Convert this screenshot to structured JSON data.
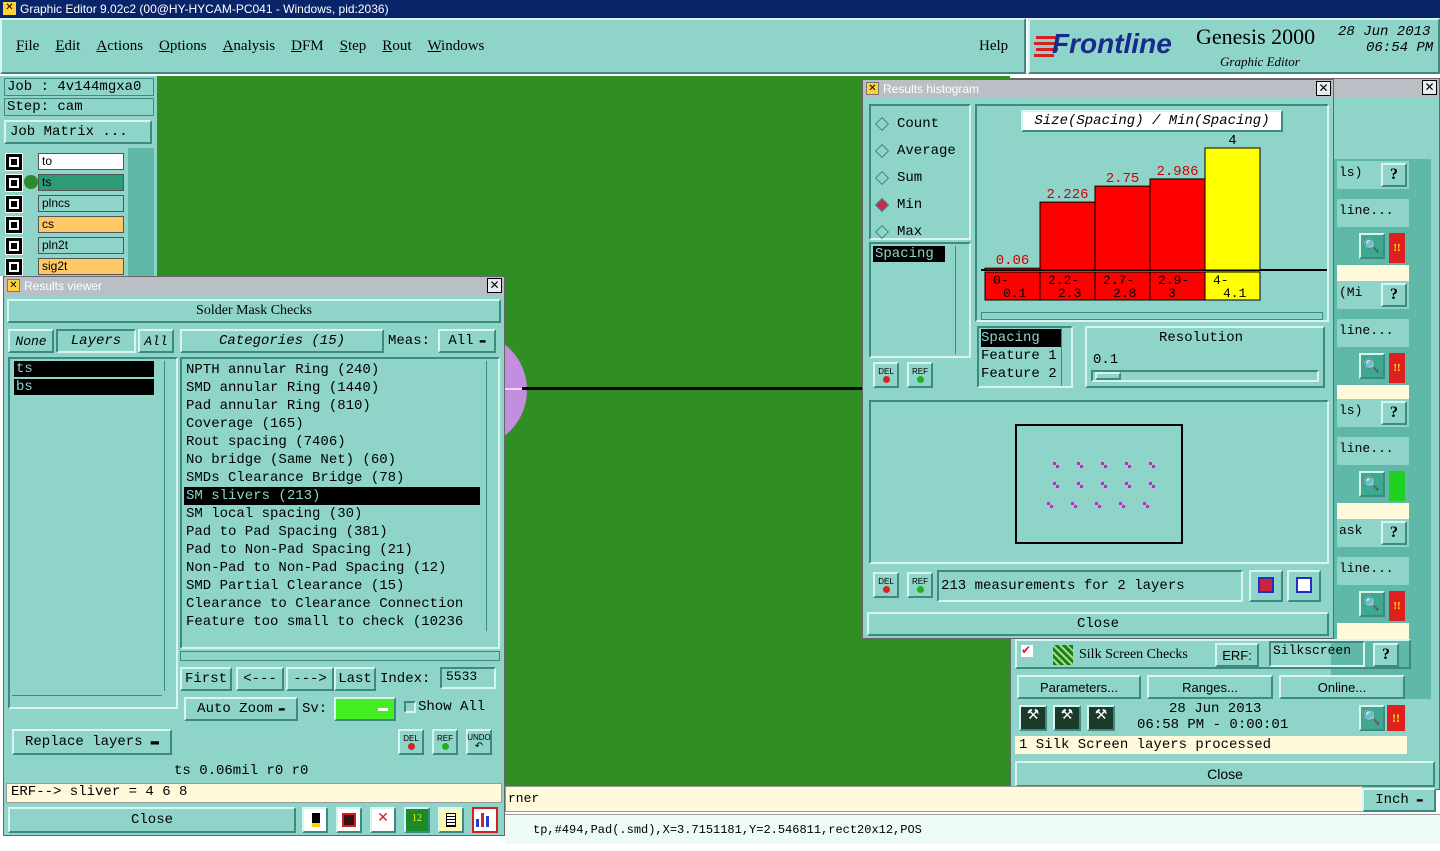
{
  "app": {
    "title": "Graphic Editor 9.02c2 (00@HY-HYCAM-PC041 - Windows, pid:2036)",
    "menu": [
      "File",
      "Edit",
      "Actions",
      "Options",
      "Analysis",
      "DFM",
      "Step",
      "Rout",
      "Windows"
    ],
    "help": "Help",
    "brand": "Frontline",
    "product": "Genesis 2000",
    "product_sub": "Graphic Editor",
    "date": "28 Jun 2013",
    "time": "06:54 PM"
  },
  "job": {
    "job_label": "Job : 4v144mgxa0",
    "step_label": "Step: cam",
    "matrix_button": "Job Matrix ...",
    "layers": [
      {
        "name": "to",
        "color": "#ffffff"
      },
      {
        "name": "ts",
        "color": "#2e9a78"
      },
      {
        "name": "plncs",
        "color": "#8fd4c8"
      },
      {
        "name": "cs",
        "color": "#ffc866"
      },
      {
        "name": "pln2t",
        "color": "#8fd4c8"
      },
      {
        "name": "sig2t",
        "color": "#ffc866"
      }
    ]
  },
  "results_viewer": {
    "title": "Results viewer",
    "header": "Solder Mask Checks",
    "none_btn": "None",
    "layers_btn": "Layers",
    "all_btn": "All",
    "categories_btn": "Categories (15)",
    "meas_label": "Meas:",
    "meas_value": "All",
    "layer_list": [
      "ts",
      "bs"
    ],
    "categories": [
      "NPTH annular Ring (240)",
      "SMD annular Ring (1440)",
      "Pad annular Ring (810)",
      "Coverage (165)",
      "Rout spacing (7406)",
      "No bridge (Same Net) (60)",
      "SMDs Clearance Bridge (78)",
      "SM slivers (213)",
      "SM local spacing (30)",
      "Pad to Pad Spacing (381)",
      "Pad to Non-Pad Spacing (21)",
      "Non-Pad to Non-Pad Spacing (12)",
      "SMD Partial Clearance (15)",
      "Clearance to Clearance Connection",
      "Feature too small to check (10236"
    ],
    "selected_index": 7,
    "first": "First",
    "prev": "<---",
    "next": "--->",
    "last": "Last",
    "index_label": "Index:",
    "index_value": "5533",
    "auto_zoom": "Auto Zoom",
    "sv_label": "Sv:",
    "show_all": "Show All",
    "replace_layers": "Replace layers",
    "del": "DEL",
    "ref": "REF",
    "undo": "UNDO",
    "status": "ts 0.06mil  r0  r0",
    "erf": "ERF--> sliver = 4 6 8",
    "close": "Close"
  },
  "histogram": {
    "title": "Results histogram",
    "modes": [
      "Count",
      "Average",
      "Sum",
      "Min",
      "Max"
    ],
    "selected_mode": "Min",
    "list": [
      "Spacing"
    ],
    "del": "DEL",
    "ref": "REF",
    "feature_list": [
      "Spacing",
      "Feature 1",
      "Feature 2"
    ],
    "resolution_label": "Resolution",
    "resolution_value": "0.1",
    "measurements": "213 measurements for 2 layers",
    "close": "Close"
  },
  "chart_data": {
    "type": "bar",
    "title": "Size(Spacing) / Min(Spacing)",
    "categories": [
      "0-0.1",
      "2.2-2.3",
      "2.7-2.8",
      "2.9-3",
      "4-4.1"
    ],
    "category_top": [
      "0-",
      "2.2-",
      "2.7-",
      "2.9-",
      "4-"
    ],
    "category_bottom": [
      "0.1",
      "2.3",
      "2.8",
      "3",
      "4.1"
    ],
    "values": [
      0.06,
      2.226,
      2.75,
      2.986,
      4
    ],
    "value_labels": [
      "0.06",
      "2.226",
      "2.75",
      "2.986",
      "4"
    ],
    "colors": [
      "#ff0000",
      "#ff0000",
      "#ff0000",
      "#ff0000",
      "#ffff00"
    ],
    "ylim": [
      0,
      4
    ]
  },
  "right_panel": {
    "frag_texts": [
      "ls)",
      "line...",
      "(Mi",
      "line...",
      "ls)",
      "line...",
      "ask",
      "line..."
    ],
    "silk_label": "Silk Screen Checks",
    "erf_label": "ERF:",
    "erf_value": "Silkscreen",
    "parameters": "Parameters...",
    "ranges": "Ranges...",
    "online": "Online...",
    "date": "28 Jun 2013",
    "time": "06:58 PM - 0:00:01",
    "status": "1 Silk Screen layers processed",
    "close": "Close",
    "question": "?",
    "alert": "!!"
  },
  "bottom": {
    "fragment": "rner",
    "units": "Inch",
    "coords": "tp,#494,Pad(.smd),X=3.7151181,Y=2.546811,rect20x12,POS"
  }
}
